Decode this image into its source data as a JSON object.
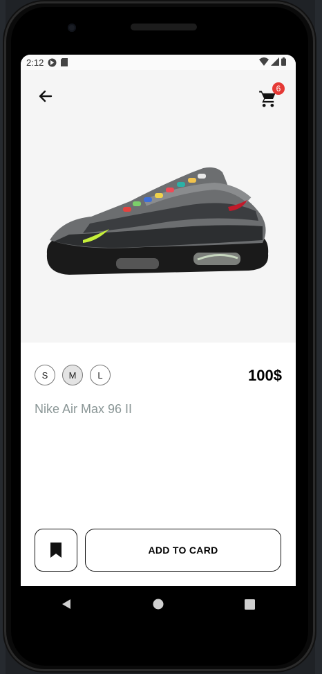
{
  "status_bar": {
    "time": "2:12",
    "icons": [
      "vpn-icon",
      "sd-card-icon",
      "wifi-icon",
      "signal-icon",
      "battery-icon"
    ]
  },
  "header": {
    "back_icon": "arrow-left-icon",
    "cart_icon": "shopping-cart-icon",
    "cart_count": "6"
  },
  "product": {
    "name": "Nike Air Max 96 II",
    "price": "100$",
    "image_icon": "sneaker-image",
    "sizes": [
      {
        "label": "S",
        "selected": false
      },
      {
        "label": "M",
        "selected": true
      },
      {
        "label": "L",
        "selected": false
      }
    ]
  },
  "actions": {
    "bookmark_icon": "bookmark-icon",
    "add_to_cart_label": "ADD TO CARD"
  },
  "system_nav": {
    "back": "nav-back-icon",
    "home": "nav-home-icon",
    "recents": "nav-recents-icon"
  },
  "colors": {
    "badge": "#e53935",
    "hero_bg": "#f5f5f5",
    "product_name": "#8a9696",
    "selected_size_bg": "#e4e4e4"
  }
}
